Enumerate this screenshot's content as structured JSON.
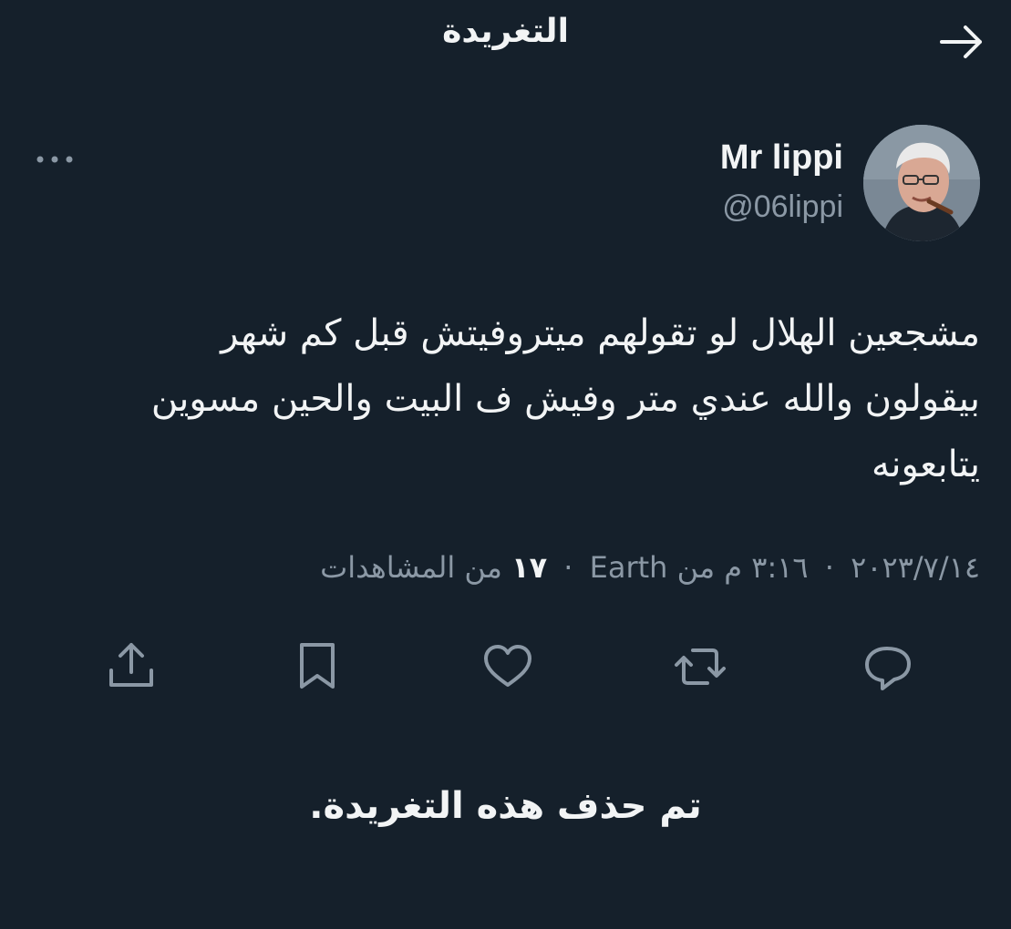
{
  "header": {
    "title": "التغريدة",
    "back_icon": "arrow-right-icon"
  },
  "tweet": {
    "author": {
      "display_name": "Mr lippi",
      "handle": "@06lippi",
      "avatar_icon": "avatar-photo"
    },
    "more_icon": "more-dots-icon",
    "text": "مشجعين الهلال لو تقولهم ميتروفيتش قبل كم شهر\nبيقولون والله عندي متر وفيش ف البيت والحين مسوين\nيتابعونه",
    "meta": {
      "date": "٢٠٢٣/٧/١٤",
      "separator": "·",
      "time": "٣:١٦ م من",
      "source": "Earth",
      "views_count": "١٧",
      "views_label": "من المشاهدات"
    },
    "actions": [
      {
        "name": "reply",
        "icon": "reply-icon"
      },
      {
        "name": "retweet",
        "icon": "retweet-icon"
      },
      {
        "name": "like",
        "icon": "heart-icon"
      },
      {
        "name": "bookmark",
        "icon": "bookmark-icon"
      },
      {
        "name": "share",
        "icon": "share-icon"
      }
    ]
  },
  "notice": {
    "deleted_text": "تم حذف هذه التغريدة."
  },
  "colors": {
    "background": "#15202b",
    "primary_text": "#f2f4f5",
    "secondary_text": "#8b98a5"
  }
}
